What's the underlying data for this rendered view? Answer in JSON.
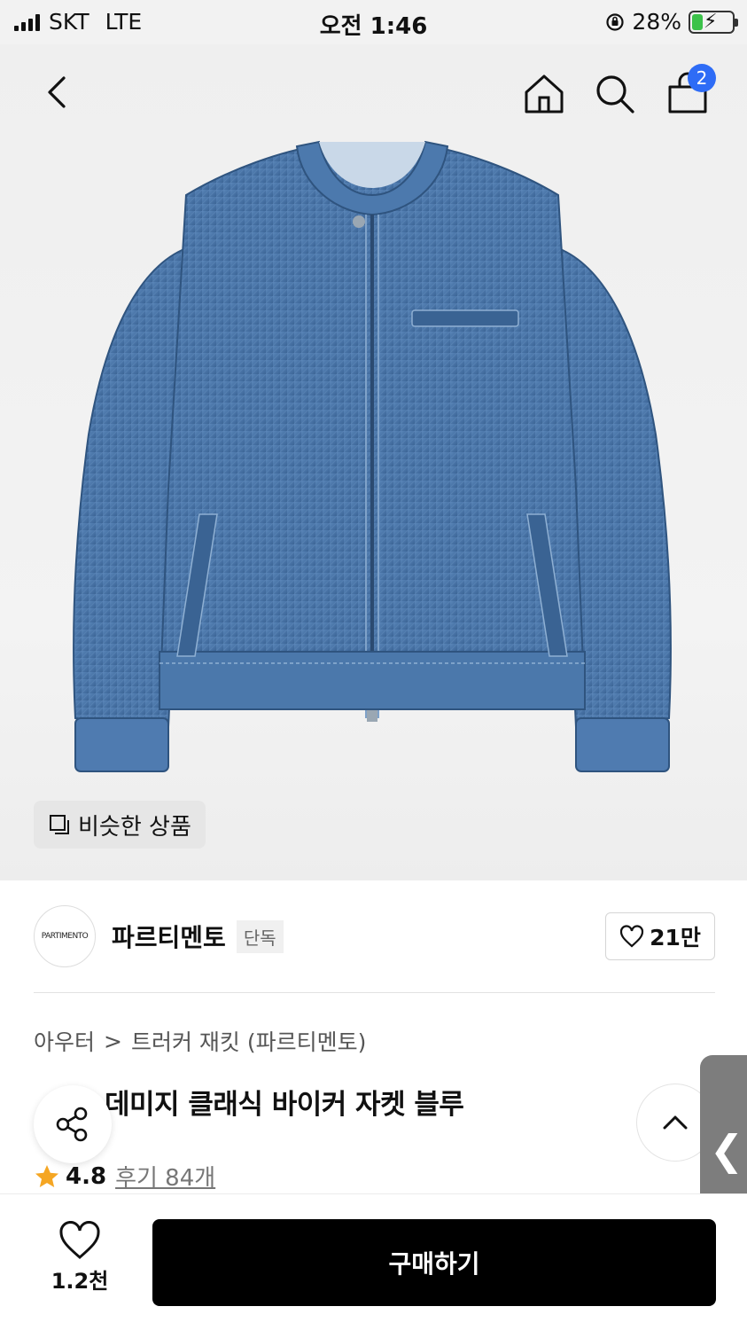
{
  "status_bar": {
    "carrier": "SKT",
    "network": "LTE",
    "time": "오전 1:46",
    "battery_percent": "28%",
    "battery_level": 0.28
  },
  "header": {
    "icons": [
      "back-icon",
      "home-icon",
      "search-icon",
      "shopping-bag-icon"
    ],
    "cart_badge": "2"
  },
  "hero": {
    "similar_products_label": "비슷한 상품"
  },
  "brand": {
    "logo_text": "PARTIMENTO",
    "name": "파르티멘토",
    "badge": "단독",
    "likes": "21만"
  },
  "breadcrumb": {
    "category": "아우터",
    "separator": ">",
    "subcategory": "트러커 재킷 (파르티멘토)"
  },
  "product": {
    "title": "데미지 클래식 바이커 자켓 블루",
    "rating": "4.8",
    "reviews_label": "후기 84개"
  },
  "side_tab": {
    "glyph": "❮"
  },
  "bottom_bar": {
    "like_count": "1.2천",
    "buy_label": "구매하기"
  },
  "colors": {
    "buy_button": "#000000",
    "badge_blue": "#2e6cf6",
    "star": "#f5a623",
    "denim": "#4a75a8"
  }
}
